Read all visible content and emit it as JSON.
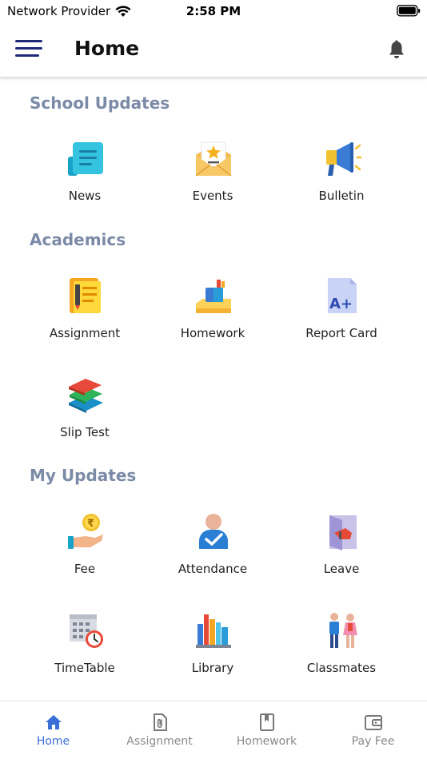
{
  "status_bar": {
    "carrier": "Network Provider",
    "time": "2:58 PM"
  },
  "header": {
    "title": "Home"
  },
  "sections": [
    {
      "title": "School Updates",
      "items": [
        {
          "label": "News",
          "icon": "news-icon"
        },
        {
          "label": "Events",
          "icon": "events-icon"
        },
        {
          "label": "Bulletin",
          "icon": "megaphone-icon"
        }
      ]
    },
    {
      "title": "Academics",
      "items": [
        {
          "label": "Assignment",
          "icon": "assignment-icon"
        },
        {
          "label": "Homework",
          "icon": "homework-icon"
        },
        {
          "label": "Report Card",
          "icon": "report-card-icon"
        },
        {
          "label": "Slip Test",
          "icon": "books-icon"
        }
      ]
    },
    {
      "title": "My Updates",
      "items": [
        {
          "label": "Fee",
          "icon": "fee-icon"
        },
        {
          "label": "Attendance",
          "icon": "attendance-icon"
        },
        {
          "label": "Leave",
          "icon": "leave-icon"
        },
        {
          "label": "TimeTable",
          "icon": "timetable-icon"
        },
        {
          "label": "Library",
          "icon": "library-icon"
        },
        {
          "label": "Classmates",
          "icon": "classmates-icon"
        }
      ]
    }
  ],
  "bottom_nav": {
    "active": "Home",
    "items": [
      {
        "label": "Home",
        "icon": "home-icon"
      },
      {
        "label": "Assignment",
        "icon": "paperclip-file-icon"
      },
      {
        "label": "Homework",
        "icon": "bookmark-book-icon"
      },
      {
        "label": "Pay Fee",
        "icon": "wallet-icon"
      }
    ]
  },
  "colors": {
    "section_title": "#7b8aa6",
    "menu": "#1f2a7a",
    "active_nav": "#3b6fd6",
    "inactive_nav": "#8a8a8a"
  }
}
